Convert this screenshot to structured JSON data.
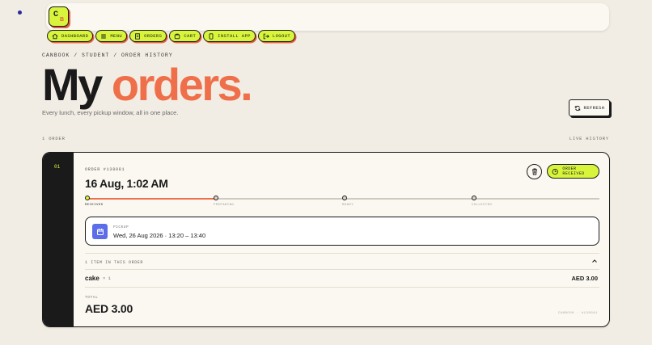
{
  "brand": {
    "logo_letter": "C",
    "logo_sub": "B"
  },
  "nav": [
    {
      "label": "DASHBOARD",
      "icon": "home-icon"
    },
    {
      "label": "MENU",
      "icon": "menu-icon"
    },
    {
      "label": "ORDERS",
      "icon": "receipt-icon"
    },
    {
      "label": "CART",
      "icon": "cart-icon"
    },
    {
      "label": "INSTALL APP",
      "icon": "phone-icon"
    },
    {
      "label": "LOGOUT",
      "icon": "logout-icon"
    }
  ],
  "breadcrumb": "CANBOOK / STUDENT / ORDER HISTORY",
  "heading": {
    "part1": "My",
    "part2": "orders."
  },
  "subtitle": "Every lunch, every pickup window, all in one place.",
  "refresh_label": "REFRESH",
  "order_count": "1 ORDER",
  "live_label": "LIVE HISTORY",
  "order": {
    "index": "01",
    "number_label": "ORDER #138081",
    "date": "16 Aug, 1:02 AM",
    "status": "ORDER RECEIVED",
    "steps": [
      "RECEIVED",
      "PREPARING",
      "READY",
      "COLLECTED"
    ],
    "completed_steps": 1,
    "pickup_label": "PICKUP",
    "pickup_value": "Wed, 26 Aug 2026 · 13:20 – 13:40",
    "items_header": "1 ITEM IN THIS ORDER",
    "items": [
      {
        "name": "cake",
        "qty": "× 1",
        "price": "AED 3.00"
      }
    ],
    "total_label": "TOTAL",
    "total": "AED 3.00",
    "footer": "CANBOOK · #138081"
  },
  "colors": {
    "accent": "#d8f53c",
    "brand_orange": "#ee6f4a",
    "dark": "#1a1a1a",
    "calendar_blue": "#5b6ee8"
  }
}
